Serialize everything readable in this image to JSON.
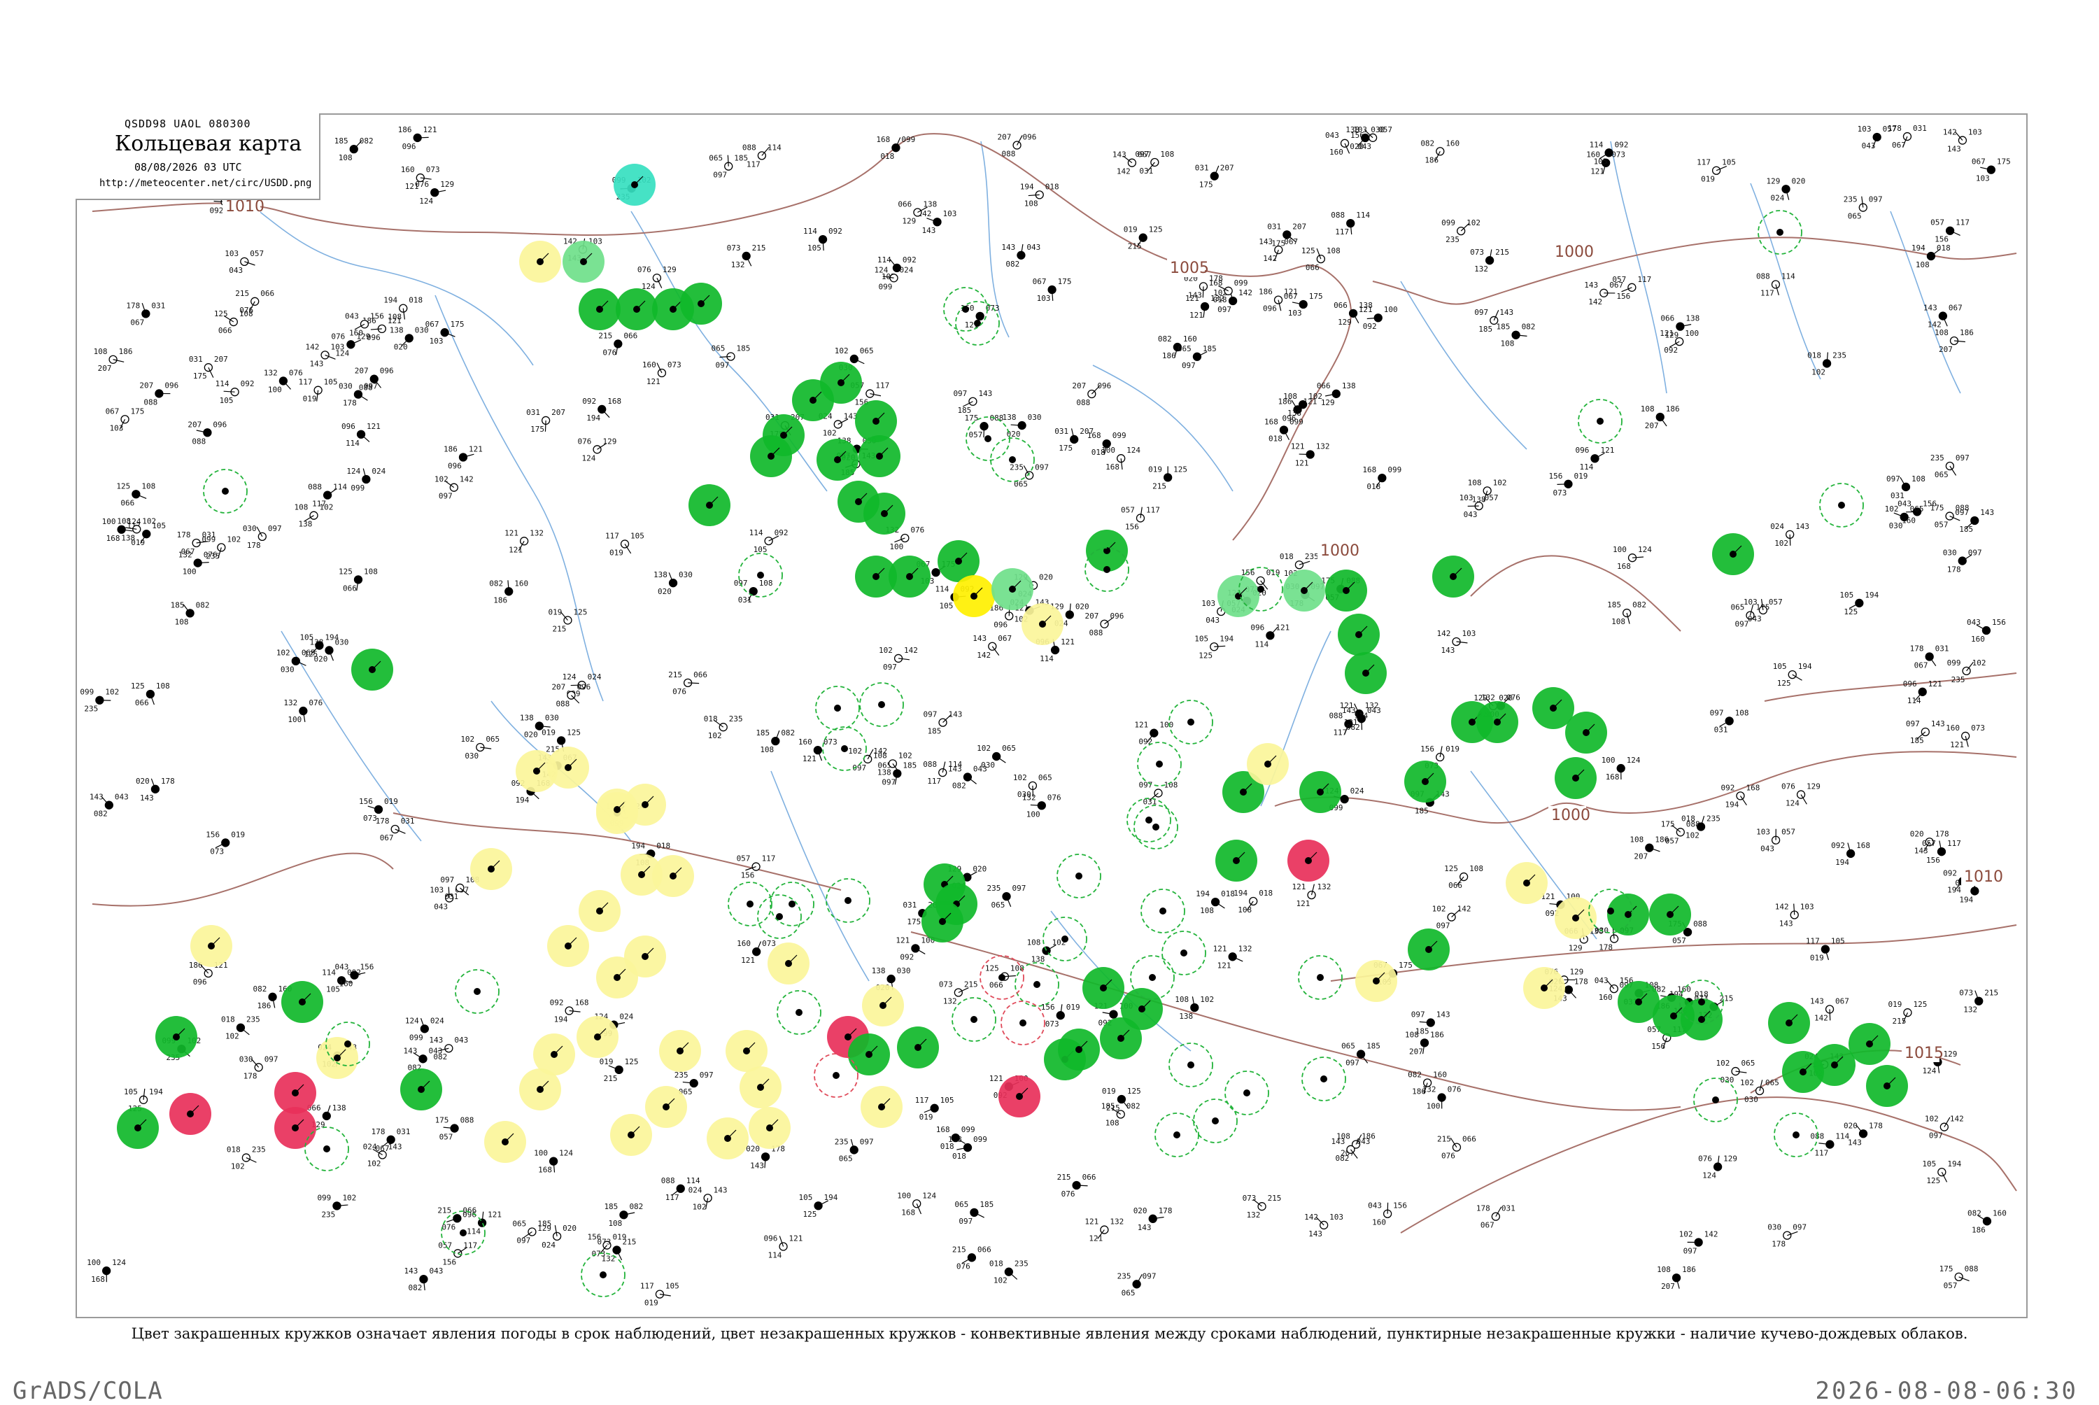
{
  "header": {
    "code": "QSDD98  UAOL  080300",
    "title": "Кольцевая карта",
    "date": "08/08/2026 03 UTC",
    "url": "http://meteocenter.net/circ/USDD.png"
  },
  "isobars": {
    "labels": [
      "1010",
      "1005",
      "1000",
      "1000",
      "1000",
      "1010",
      "1015"
    ]
  },
  "colors": {
    "green": "#10b82a",
    "light_green": "#6fe08a",
    "yellow_light": "#fbf59a",
    "yellow": "#fff000",
    "red": "#e8305a",
    "cyan": "#36e0c0",
    "isobar": "#a7716a",
    "river": "#7fb0e0",
    "dashed_green": "#22b33a",
    "dashed_red": "#e04a5a"
  },
  "station_numbers": [
    "102",
    "097",
    "103",
    "088",
    "121",
    "076",
    "138",
    "065",
    "143",
    "057",
    "114",
    "100",
    "129",
    "030",
    "185",
    "043",
    "117",
    "092",
    "124",
    "020",
    "097",
    "082",
    "156",
    "105",
    "168",
    "024",
    "178",
    "108",
    "160",
    "019",
    "194",
    "099",
    "143",
    "031",
    "186",
    "073",
    "125",
    "018",
    "102",
    "067",
    "207",
    "121",
    "215",
    "108",
    "235",
    "142",
    "175",
    "096",
    "132",
    "066"
  ],
  "legend": {
    "caption": "Цвет закрашенных кружков означает явления погоды в срок наблюдений, цвет незакрашенных кружков - конвективные явления между сроками наблюдений, пунктирные незакрашенные кружки - наличие кучево-дождевых облаков."
  },
  "footer": {
    "left": "GrADS/COLA",
    "right": "2026-08-08-06:30"
  }
}
